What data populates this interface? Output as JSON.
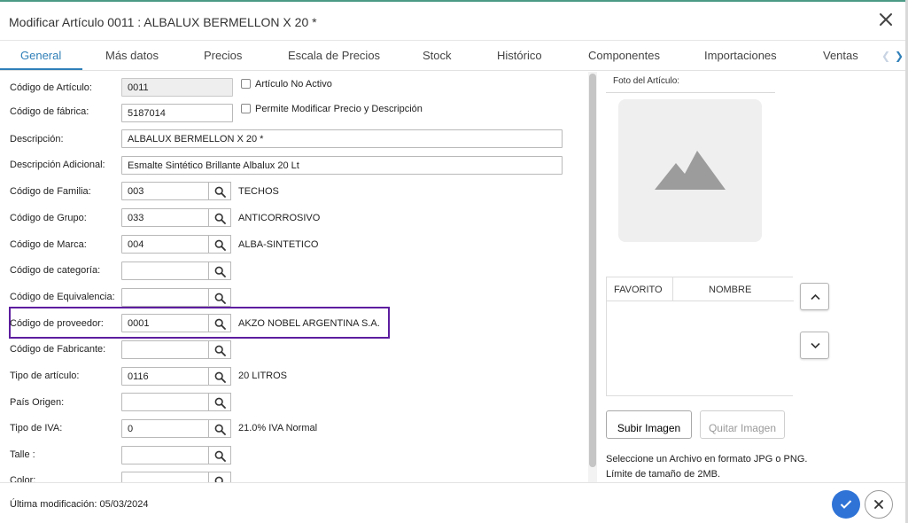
{
  "window": {
    "title": "Modificar Artículo 0011 : ALBALUX BERMELLON X 20 *"
  },
  "tabs": [
    {
      "label": "General"
    },
    {
      "label": "Más datos"
    },
    {
      "label": "Precios"
    },
    {
      "label": "Escala de Precios"
    },
    {
      "label": "Stock"
    },
    {
      "label": "Histórico"
    },
    {
      "label": "Componentes"
    },
    {
      "label": "Importaciones"
    },
    {
      "label": "Ventas"
    }
  ],
  "form": {
    "codigo_articulo": {
      "label": "Código de Artículo:",
      "value": "0011"
    },
    "articulo_no_activo": {
      "label": "Artículo No Activo",
      "checked": false
    },
    "codigo_fabrica": {
      "label": "Código de fábrica:",
      "value": "5187014"
    },
    "permite_modificar": {
      "label": "Permite Modificar Precio y Descripción",
      "checked": false
    },
    "descripcion": {
      "label": "Descripción:",
      "value": "ALBALUX BERMELLON X 20  *"
    },
    "descripcion_adicional": {
      "label": "Descripción Adicional:",
      "value": "Esmalte Sintético Brillante Albalux 20 Lt"
    },
    "familia": {
      "label": "Código de Familia:",
      "value": "003",
      "desc": "TECHOS"
    },
    "grupo": {
      "label": "Código de Grupo:",
      "value": "033",
      "desc": "ANTICORROSIVO"
    },
    "marca": {
      "label": "Código de Marca:",
      "value": "004",
      "desc": "ALBA-SINTETICO"
    },
    "categoria": {
      "label": "Código de categoría:",
      "value": "",
      "desc": ""
    },
    "equivalencia": {
      "label": "Código de Equivalencia:",
      "value": "",
      "desc": ""
    },
    "proveedor": {
      "label": "Código de proveedor:",
      "value": "0001",
      "desc": "AKZO NOBEL ARGENTINA S.A."
    },
    "fabricante": {
      "label": "Código de Fabricante:",
      "value": "",
      "desc": ""
    },
    "tipo_articulo": {
      "label": "Tipo de artículo:",
      "value": "0116",
      "desc": "20 LITROS"
    },
    "pais_origen": {
      "label": "País Origen:",
      "value": "",
      "desc": ""
    },
    "tipo_iva": {
      "label": "Tipo de IVA:",
      "value": "0",
      "desc": "21.0% IVA Normal"
    },
    "talle": {
      "label": "Talle :",
      "value": "",
      "desc": ""
    },
    "color": {
      "label": "Color:",
      "value": "",
      "desc": ""
    }
  },
  "photo": {
    "label": "Foto del Artículo:",
    "table_headers": [
      "FAVORITO",
      "NOMBRE"
    ],
    "upload_label": "Subir Imagen",
    "remove_label": "Quitar Imagen",
    "hint_1": "Seleccione un Archivo en formato JPG o PNG.",
    "hint_2": "Límite de tamaño de 2MB."
  },
  "footer": {
    "last_modified": "Última modificación: 05/03/2024"
  },
  "colors": {
    "accent": "#2f7fb8",
    "highlight": "#5d1d9f",
    "ok": "#2f73d6"
  }
}
